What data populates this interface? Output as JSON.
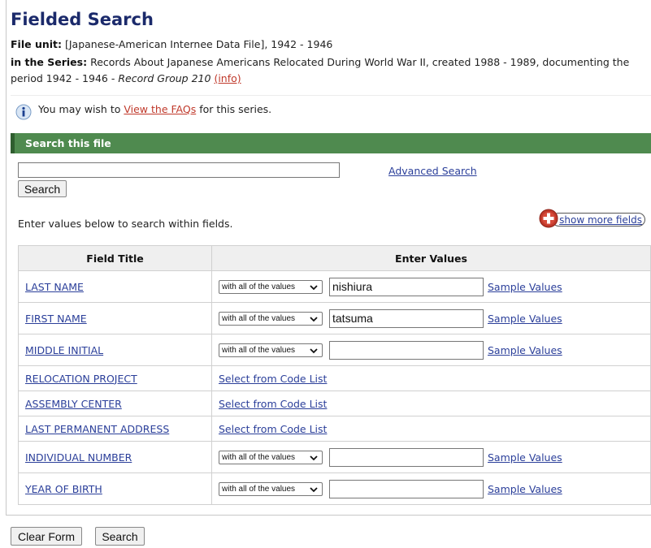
{
  "page_title": "Fielded Search",
  "file_unit": {
    "label": "File unit:",
    "value": "[Japanese-American Internee Data File], 1942 - 1946"
  },
  "series": {
    "label": "in the Series:",
    "text": "Records About Japanese Americans Relocated During World War II, created 1988 - 1989, documenting the period 1942 - 1946 - ",
    "record_group": "Record Group 210",
    "info_link": "(info)"
  },
  "faq": {
    "prefix": "You may wish to ",
    "link": "View the FAQs",
    "suffix": " for this series."
  },
  "search_panel": {
    "header": "Search this file",
    "input_value": "",
    "search_button": "Search",
    "advanced_link": "Advanced Search",
    "instructions": "Enter values below to search within fields.",
    "show_more_fields": "show more fields"
  },
  "table": {
    "headers": [
      "Field Title",
      "Enter Values"
    ],
    "operator_label": "with all of the values",
    "sample_link": "Sample Values",
    "code_list_link": "Select from Code List",
    "rows": [
      {
        "title": "LAST NAME",
        "type": "text",
        "value": "nishiura"
      },
      {
        "title": "FIRST NAME",
        "type": "text",
        "value": "tatsuma"
      },
      {
        "title": "MIDDLE INITIAL",
        "type": "text",
        "value": ""
      },
      {
        "title": "RELOCATION PROJECT",
        "type": "code"
      },
      {
        "title": "ASSEMBLY CENTER",
        "type": "code"
      },
      {
        "title": "LAST PERMANENT ADDRESS",
        "type": "code"
      },
      {
        "title": "INDIVIDUAL NUMBER",
        "type": "text",
        "value": ""
      },
      {
        "title": "YEAR OF BIRTH",
        "type": "text",
        "value": ""
      }
    ]
  },
  "footer": {
    "clear_button": "Clear Form",
    "search_button": "Search"
  },
  "icons": {
    "info": "info-icon",
    "plus": "plus-circle-icon",
    "chevron": "chevron-down-icon"
  },
  "colors": {
    "title": "#1b2a6b",
    "header_bar": "#4f8a4f",
    "link": "#2b3f9a",
    "info_link": "#c0392b",
    "plus_icon": "#c0392b"
  }
}
